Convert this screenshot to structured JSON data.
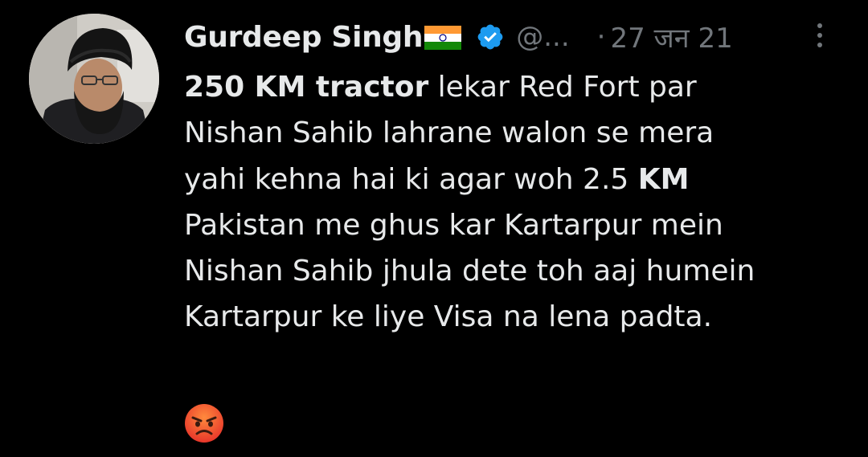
{
  "tweet": {
    "author": {
      "display_name": "Gurdeep Singh",
      "flag_icon": "india-flag-icon",
      "verified_icon": "verified-badge-icon",
      "handle": "@...",
      "separator": "·",
      "date": "27 जन 21"
    },
    "menu_icon": "more-vertical-icon",
    "text": {
      "seg1_bold": "250 KM tractor",
      "seg2": " lekar Red Fort par\nNishan Sahib lahrane walon se mera\nyahi kehna hai ki agar woh 2.5 ",
      "seg3_bold": "KM",
      "seg4": "\nPakistan me ghus kar Kartarpur mein\nNishan Sahib jhula dete toh aaj humein\nKartarpur ke liye Visa na lena padta."
    },
    "emoji_icon": "angry-face-emoji",
    "colors": {
      "background": "#000000",
      "primary_text": "#e7e9ea",
      "secondary_text": "#71767b",
      "verified_blue": "#1d9bf0"
    }
  }
}
